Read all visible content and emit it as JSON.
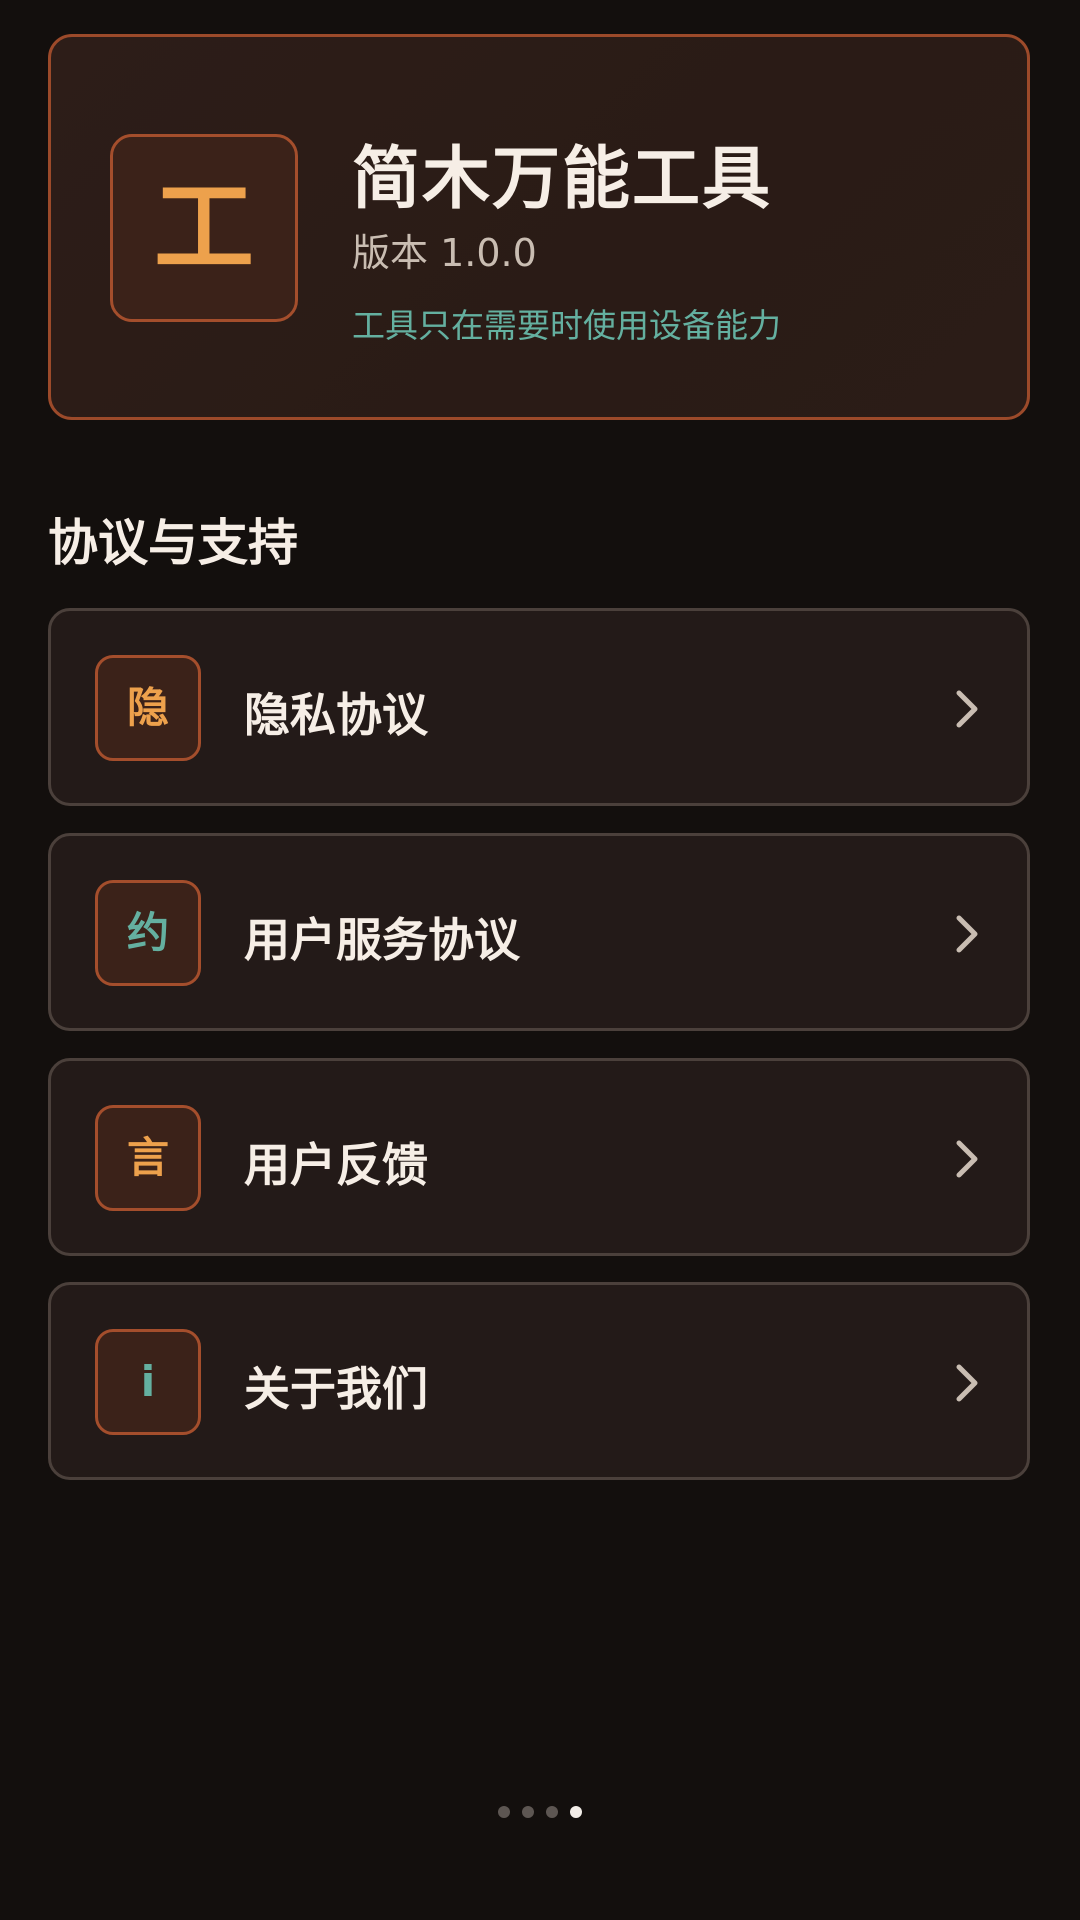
{
  "app": {
    "icon_char": "工",
    "title": "简木万能工具",
    "version": "版本 1.0.0",
    "tagline": "工具只在需要时使用设备能力"
  },
  "section": {
    "title": "协议与支持"
  },
  "menu": [
    {
      "icon_char": "隐",
      "icon_color": "#eda14c",
      "label": "隐私协议",
      "icon": "chevron-right-icon"
    },
    {
      "icon_char": "约",
      "icon_color": "#64b0a0",
      "label": "用户服务协议",
      "icon": "chevron-right-icon"
    },
    {
      "icon_char": "言",
      "icon_color": "#eda14c",
      "label": "用户反馈",
      "icon": "chevron-right-icon"
    },
    {
      "icon_char": "i",
      "icon_color": "#64b0a0",
      "label": "关于我们",
      "icon": "chevron-right-icon"
    }
  ],
  "pager": {
    "total": 4,
    "active_index": 3
  },
  "colors": {
    "background": "#130f0d",
    "accent_orange": "#eda14c",
    "accent_teal": "#64b0a0",
    "card_border": "#9c4a2a"
  }
}
